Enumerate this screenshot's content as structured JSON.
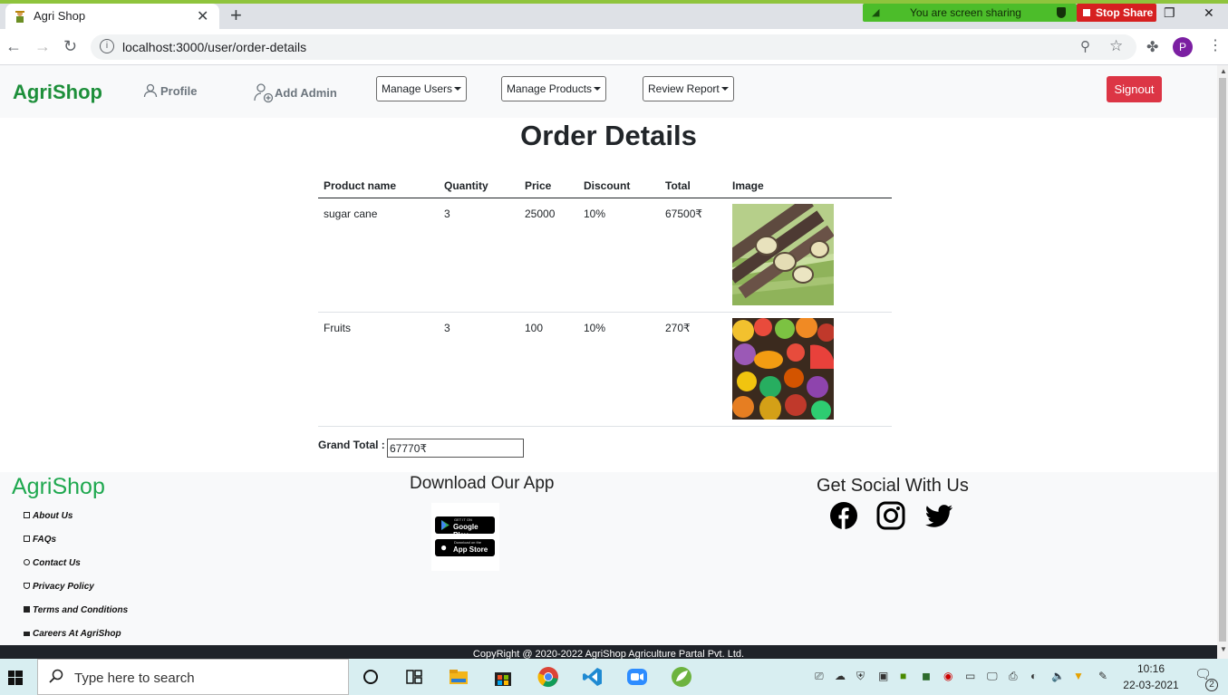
{
  "browser": {
    "tab_title": "Agri Shop",
    "url": "localhost:3000/user/order-details",
    "profile_initial": "P"
  },
  "screen_share": {
    "status": "You are screen sharing",
    "stop_label": "Stop Share"
  },
  "navbar": {
    "brand": "AgriShop",
    "profile": "Profile",
    "add_admin": "Add Admin",
    "manage_users": "Manage Users",
    "manage_products": "Manage Products",
    "review_report": "Review Report",
    "signout": "Signout"
  },
  "page_title": "Order Details",
  "table": {
    "headers": [
      "Product name",
      "Quantity",
      "Price",
      "Discount",
      "Total",
      "Image"
    ],
    "rows": [
      {
        "name": "sugar cane",
        "quantity": "3",
        "price": "25000",
        "discount": "10%",
        "total": "67500₹",
        "image": "sugar-cane-image"
      },
      {
        "name": "Fruits",
        "quantity": "3",
        "price": "100",
        "discount": "10%",
        "total": "270₹",
        "image": "fruits-image"
      }
    ]
  },
  "grand_total": {
    "label": "Grand Total :",
    "value": "67770₹"
  },
  "footer": {
    "brand": "AgriShop",
    "links": [
      "About Us",
      "FAQs",
      "Contact Us",
      "Privacy Policy",
      "Terms and Conditions",
      "Careers At AgriShop"
    ],
    "download_heading": "Download Our App",
    "google_play_small": "GET IT ON",
    "google_play": "Google Play",
    "app_store_small": "Download on the",
    "app_store": "App Store",
    "social_heading": "Get Social With Us",
    "social_icons": [
      "facebook-icon",
      "instagram-icon",
      "twitter-icon"
    ],
    "copyright": "CopyRight @ 2020-2022 AgriShop Agriculture Partal Pvt. Ltd."
  },
  "taskbar": {
    "search_placeholder": "Type here to search",
    "time": "10:16",
    "date": "22-03-2021",
    "notification_count": "2"
  },
  "colors": {
    "brand_green": "#1d8f3a",
    "signout_red": "#dc3545",
    "share_green": "#4cbd2a"
  }
}
